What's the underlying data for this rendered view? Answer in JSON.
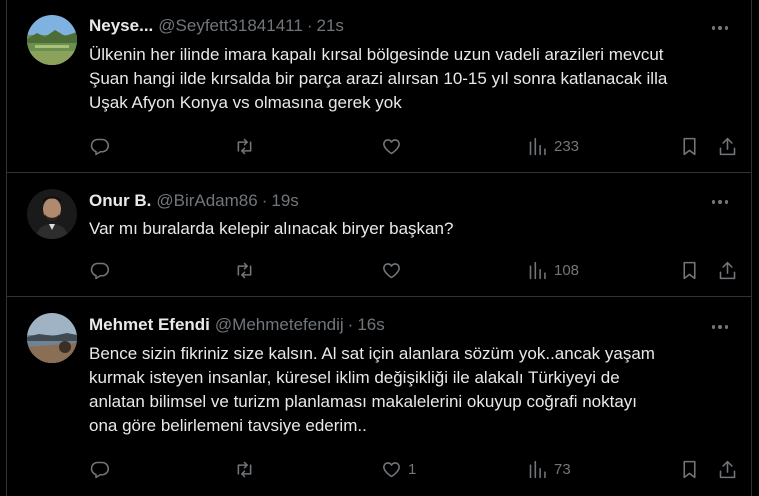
{
  "tweets": [
    {
      "name": "Neyse...",
      "handle": "@Seyfett31841411",
      "separator": "·",
      "time": "21s",
      "text_lines": [
        "Ülkenin her ilinde imara kapalı kırsal bölgesinde uzun vadeli arazileri mevcut",
        "Şuan hangi ilde kırsalda bir parça arazi alırsan 10-15 yıl sonra katlanacak illa",
        "Uşak Afyon Konya vs olmasına gerek yok"
      ],
      "reply_count": "",
      "retweet_count": "",
      "like_count": "",
      "view_count": "233"
    },
    {
      "name": "Onur B.",
      "handle": "@BirAdam86",
      "separator": "·",
      "time": "19s",
      "text_lines": [
        "Var mı buralarda kelepir alınacak biryer başkan?"
      ],
      "reply_count": "",
      "retweet_count": "",
      "like_count": "",
      "view_count": "108"
    },
    {
      "name": "Mehmet Efendi",
      "handle": "@Mehmetefendij",
      "separator": "·",
      "time": "16s",
      "text_lines": [
        "Bence sizin  fikriniz size kalsın. Al sat için alanlara sözüm yok..ancak yaşam",
        "kurmak isteyen insanlar, küresel iklim değişikliği ile alakalı Türkiyeyi de",
        "anlatan  bilimsel  ve turizm planlaması makalelerini okuyup coğrafi noktayı",
        "ona göre belirlemeni tavsiye ederim.."
      ],
      "reply_count": "",
      "retweet_count": "",
      "like_count": "1",
      "view_count": "73"
    }
  ],
  "icons": {
    "reply": "reply-icon",
    "retweet": "retweet-icon",
    "like": "heart-icon",
    "views": "views-chart-icon",
    "bookmark": "bookmark-icon",
    "share": "share-icon",
    "more": "more-options-icon"
  },
  "colors": {
    "background": "#000000",
    "text": "#e7e9ea",
    "secondary": "#71767b",
    "border": "#2f3336"
  }
}
